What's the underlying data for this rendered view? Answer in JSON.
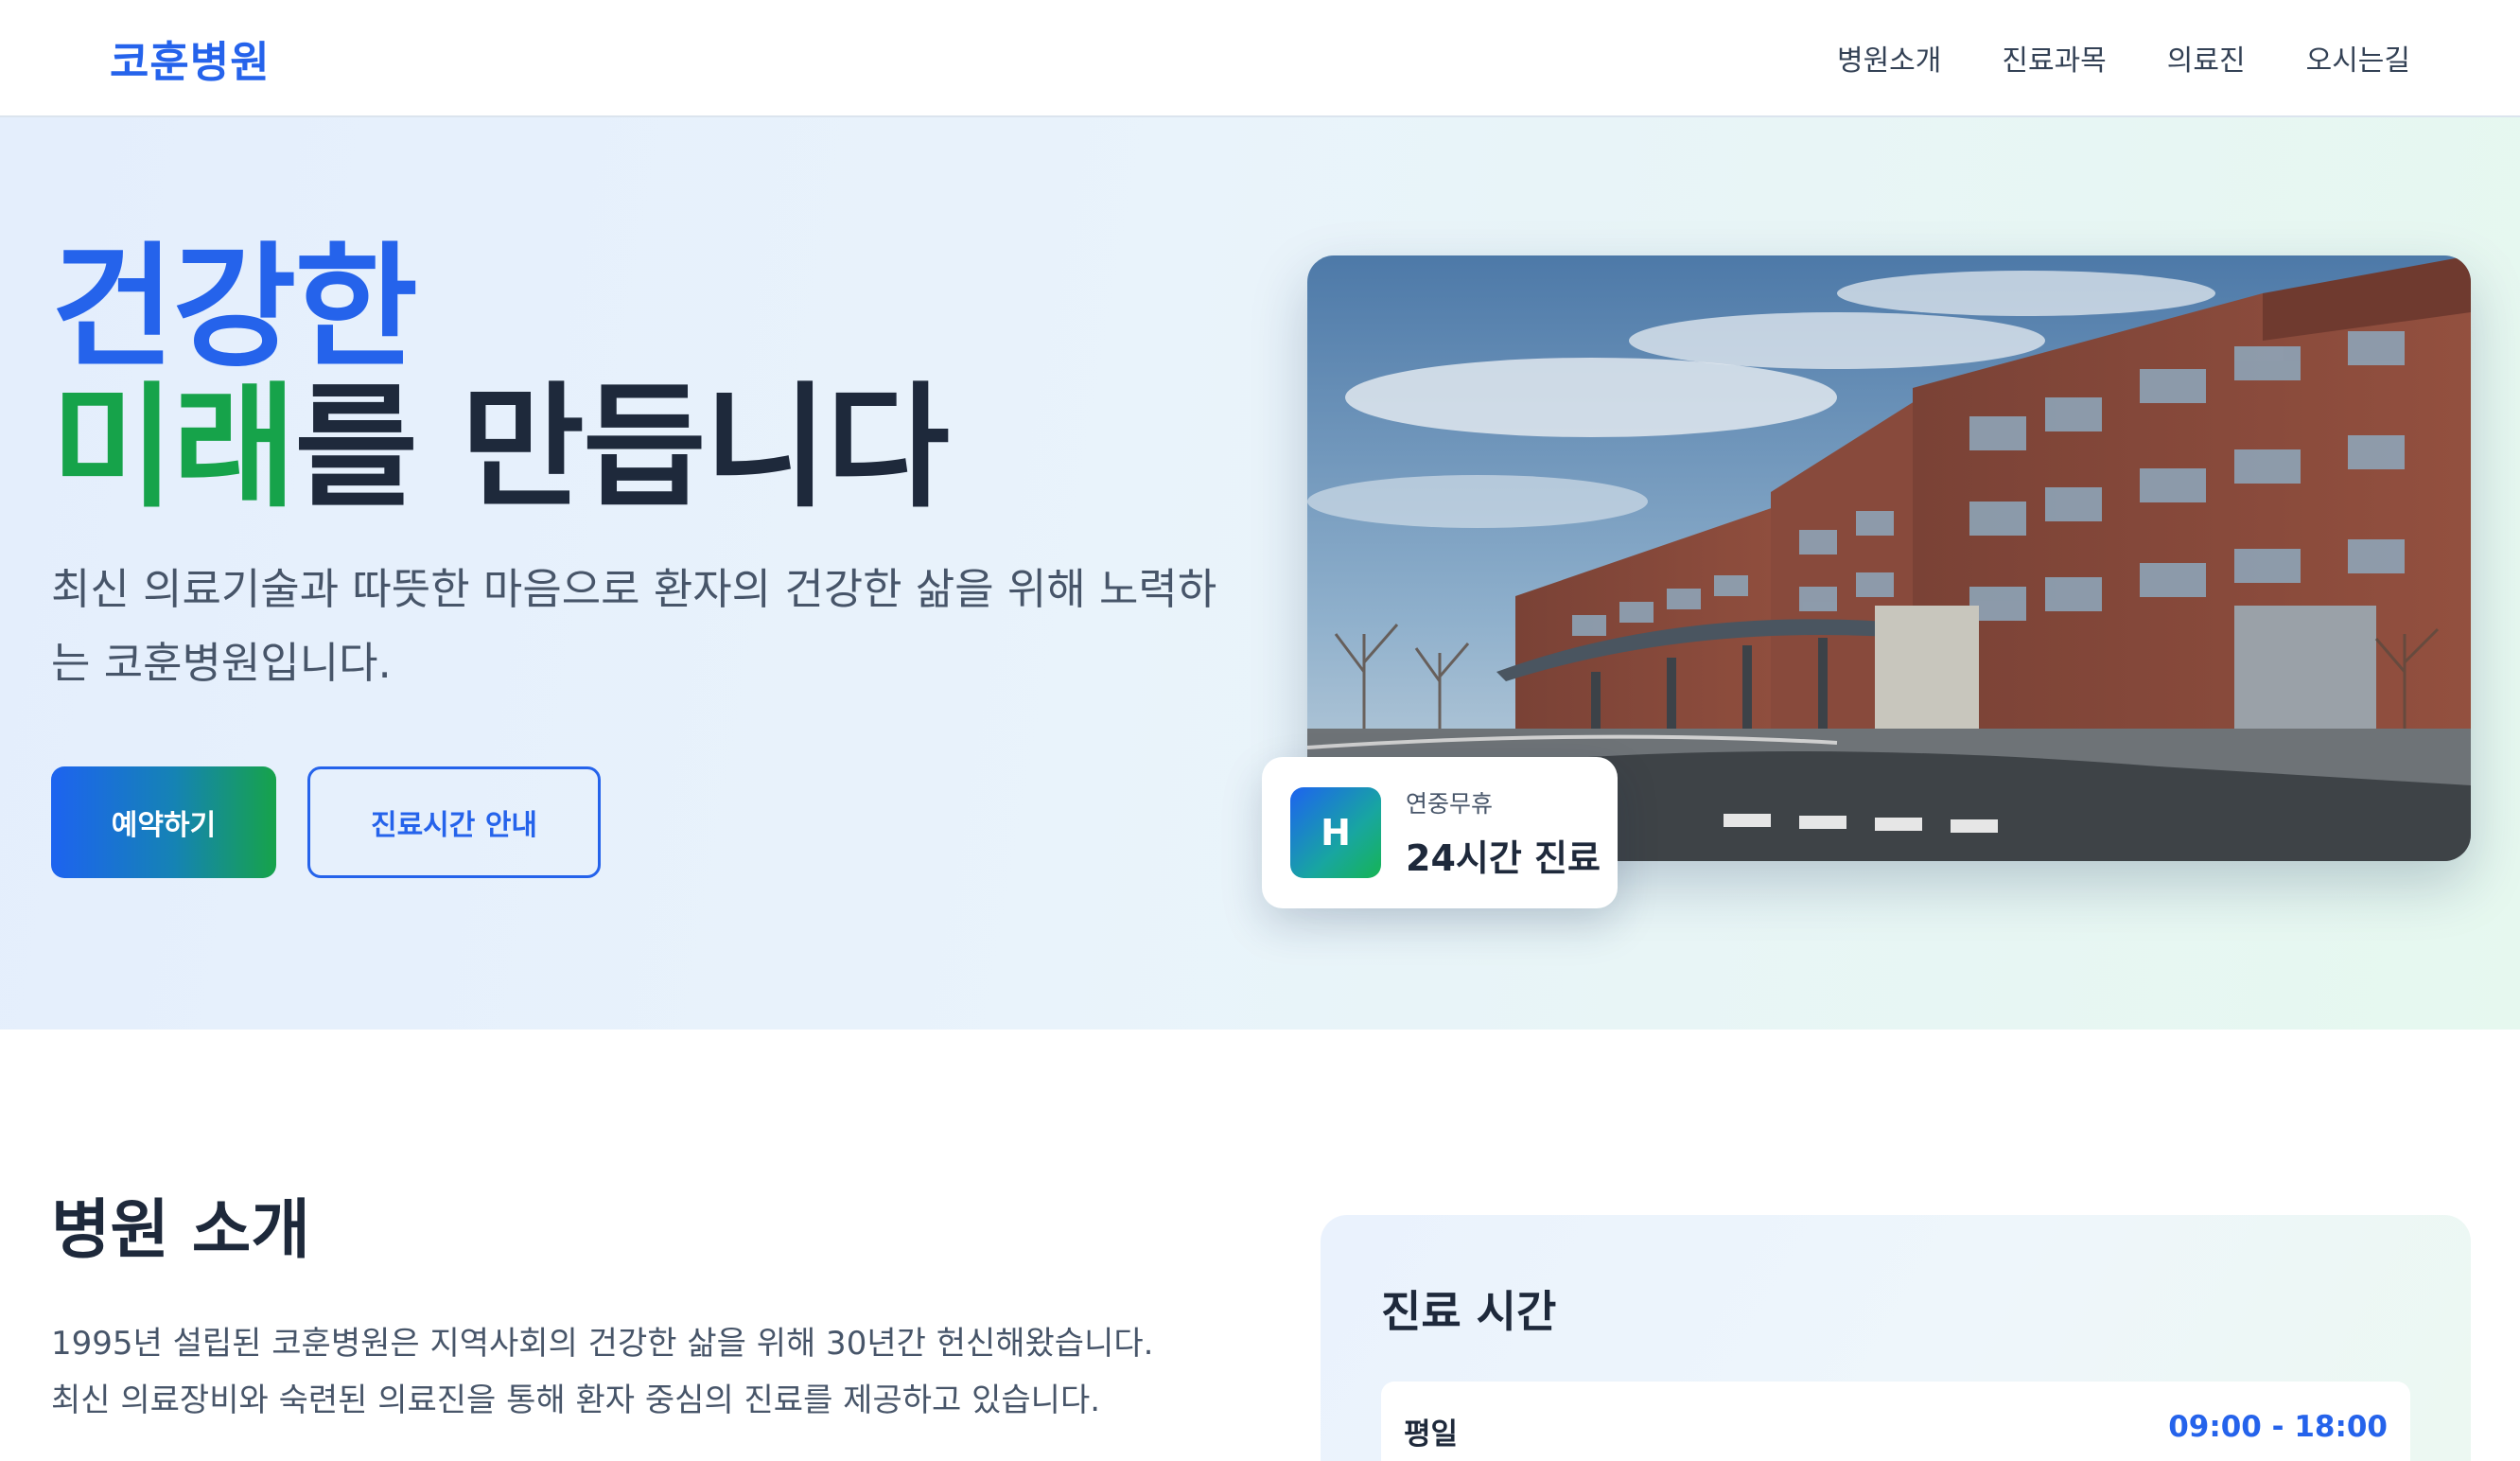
{
  "header": {
    "logo": "코훈병원",
    "nav": [
      "병원소개",
      "진료과목",
      "의료진",
      "오시는길"
    ]
  },
  "hero": {
    "title_line1": "건강한",
    "title_highlight": "미래",
    "title_rest": "를 만듭니다",
    "description": "최신 의료기술과 따뜻한 마음으로 환자의 건강한 삶을 위해 노력하는 코훈병원입니다.",
    "primary_button": "예약하기",
    "secondary_button": "진료시간 안내"
  },
  "badge": {
    "icon_letter": "H",
    "subtitle": "연중무휴",
    "title": "24시간 진료"
  },
  "about": {
    "title": "병원 소개",
    "description": "1995년 설립된 코훈병원은 지역사회의 건강한 삶을 위해 30년간 헌신해왔습니다. 최신 의료장비와 숙련된 의료진을 통해 환자 중심의 진료를 제공하고 있습니다."
  },
  "hours": {
    "title": "진료 시간",
    "rows": [
      {
        "day": "평일",
        "time": "09:00 - 18:00"
      }
    ]
  },
  "colors": {
    "brand_blue": "#2563eb",
    "brand_green": "#16a34a",
    "text_dark": "#1e293b"
  }
}
